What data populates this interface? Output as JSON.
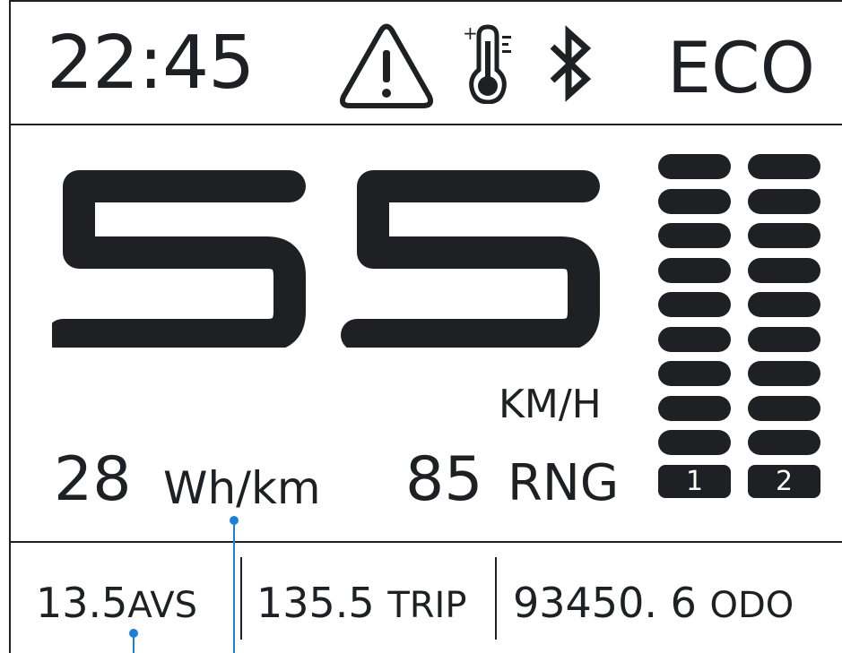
{
  "status_bar": {
    "time": "22:45",
    "mode": "ECO",
    "icons": [
      "warning-triangle-icon",
      "temperature-icon",
      "bluetooth-icon"
    ],
    "thermometer_marks": "+"
  },
  "speed": {
    "value": "55",
    "unit": "KM/H"
  },
  "consumption": {
    "value": "28",
    "unit": "Wh/km"
  },
  "range": {
    "value": "85",
    "unit": "RNG"
  },
  "battery_bars": [
    {
      "label": "1",
      "segments": 9
    },
    {
      "label": "2",
      "segments": 9
    }
  ],
  "stats": {
    "avs": {
      "value": "13.5",
      "unit": "AVS"
    },
    "trip": {
      "value": "135.5",
      "unit": "TRIP"
    },
    "odo": {
      "value": "93450. 6",
      "unit": "ODO"
    }
  },
  "colors": {
    "ink": "#1f2024",
    "background": "#ffffff",
    "callout": "#1f7fd4"
  }
}
